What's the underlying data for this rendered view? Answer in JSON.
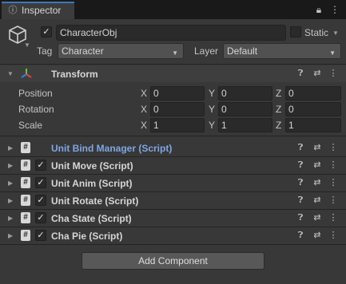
{
  "window": {
    "tab_label": "Inspector",
    "tab_icon": "info-icon"
  },
  "header": {
    "object_name": "CharacterObj",
    "active": true,
    "static_label": "Static",
    "static_checked": false,
    "tag_label": "Tag",
    "tag_value": "Character",
    "layer_label": "Layer",
    "layer_value": "Default"
  },
  "transform": {
    "title": "Transform",
    "rows": [
      {
        "label": "Position",
        "x": "0",
        "y": "0",
        "z": "0"
      },
      {
        "label": "Rotation",
        "x": "0",
        "y": "0",
        "z": "0"
      },
      {
        "label": "Scale",
        "x": "1",
        "y": "1",
        "z": "1"
      }
    ],
    "axis": {
      "x": "X",
      "y": "Y",
      "z": "Z"
    }
  },
  "components": [
    {
      "name": "Unit Bind Manager (Script)",
      "has_checkbox": false,
      "highlight": true
    },
    {
      "name": "Unit Move (Script)",
      "has_checkbox": true,
      "highlight": false
    },
    {
      "name": "Unit Anim (Script)",
      "has_checkbox": true,
      "highlight": false
    },
    {
      "name": "Unit Rotate (Script)",
      "has_checkbox": true,
      "highlight": false
    },
    {
      "name": "Cha State (Script)",
      "has_checkbox": true,
      "highlight": false
    },
    {
      "name": "Cha Pie (Script)",
      "has_checkbox": true,
      "highlight": false
    }
  ],
  "add_component_label": "Add Component",
  "colors": {
    "accent": "#3a79bb",
    "highlight_text": "#7fa6e3",
    "background": "#383838"
  }
}
